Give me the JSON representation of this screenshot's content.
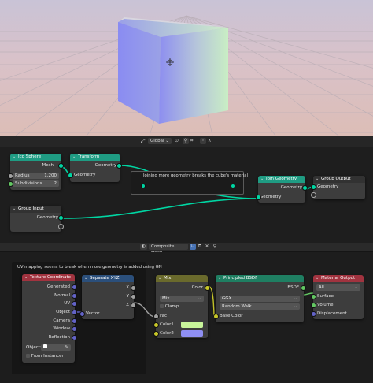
{
  "viewport": {
    "header": {
      "transform_orientation": "Global"
    }
  },
  "geo_editor": {
    "nodes": {
      "ico_sphere": {
        "title": "Ico Sphere",
        "output": "Mesh",
        "radius_label": "Radius",
        "radius_value": "1.200",
        "subdiv_label": "Subdivisions",
        "subdiv_value": "2"
      },
      "transform": {
        "title": "Transform",
        "output": "Geometry",
        "input": "Geometry"
      },
      "group_input": {
        "title": "Group Input",
        "output": "Geometry"
      },
      "join_geometry": {
        "title": "Join Geometry",
        "output": "Geometry",
        "input": "Geometry"
      },
      "group_output": {
        "title": "Group Output",
        "input": "Geometry"
      }
    },
    "frame_note": "Joining more geometry breaks the cube's material"
  },
  "shader_editor": {
    "header": {
      "material_name": "Composite Mesh"
    },
    "frame_label": "UV mapping seems to break when more geometry is added using GN",
    "nodes": {
      "texture_coordinate": {
        "title": "Texture Coordinate",
        "outputs": [
          "Generated",
          "Normal",
          "UV",
          "Object",
          "Camera",
          "Window",
          "Reflection"
        ],
        "object_label": "Object:",
        "from_instancer": "From Instancer"
      },
      "separate_xyz": {
        "title": "Separate XYZ",
        "outputs": [
          "X",
          "Y",
          "Z"
        ],
        "input": "Vector"
      },
      "mix": {
        "title": "Mix",
        "mode": "Mix",
        "clamp": "Clamp",
        "fac": "Fac",
        "color1": "Color1",
        "color2": "Color2",
        "output": "Color"
      },
      "principled_bsdf": {
        "title": "Principled BSDF",
        "output": "BSDF",
        "distribution": "GGX",
        "subsurface": "Random Walk",
        "base_color": "Base Color"
      },
      "material_output": {
        "title": "Material Output",
        "target": "All",
        "inputs": [
          "Surface",
          "Volume",
          "Displacement"
        ]
      }
    }
  },
  "colors": {
    "geometry_socket": "#00d6a3",
    "color1": "#c8f59a",
    "color2": "#8e8ef2",
    "cube_left": "#8d8ef0",
    "cube_right": "#c9eec4"
  }
}
